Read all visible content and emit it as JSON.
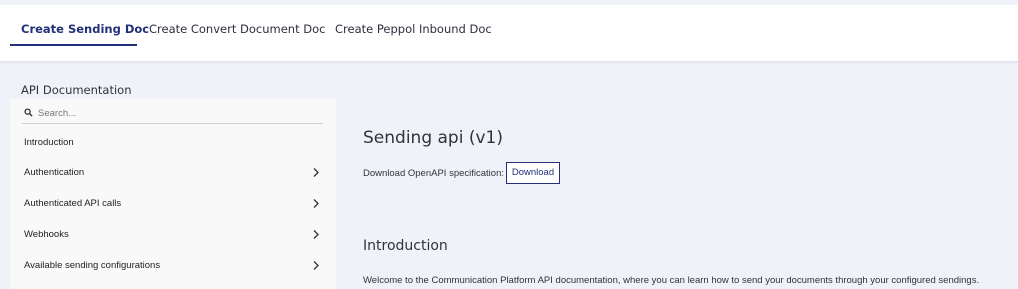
{
  "tabs": [
    {
      "label": "Create Sending Doc",
      "active": true
    },
    {
      "label": "Create Convert Document Doc",
      "active": false
    },
    {
      "label": "Create Peppol Inbound Doc",
      "active": false
    }
  ],
  "api_doc_title": "API Documentation",
  "search": {
    "placeholder": "Search...",
    "value": ""
  },
  "sidebar": {
    "items": [
      {
        "label": "Introduction",
        "expandable": false
      },
      {
        "label": "Authentication",
        "expandable": true
      },
      {
        "label": "Authenticated API calls",
        "expandable": true
      },
      {
        "label": "Webhooks",
        "expandable": true
      },
      {
        "label": "Available sending configurations",
        "expandable": true
      }
    ]
  },
  "content": {
    "title": "Sending api (v1)",
    "download_label": "Download OpenAPI specification:",
    "download_button": "Download",
    "section_title": "Introduction",
    "intro_text": "Welcome to the Communication Platform API documentation, where you can learn how to send your documents through your configured sendings."
  },
  "colors": {
    "accent": "#23307a",
    "page_background": "#f0f2fa",
    "sidebar_background": "#f9f9f9"
  },
  "icons": {
    "search": "search-icon",
    "chevron": "chevron-right-icon"
  }
}
